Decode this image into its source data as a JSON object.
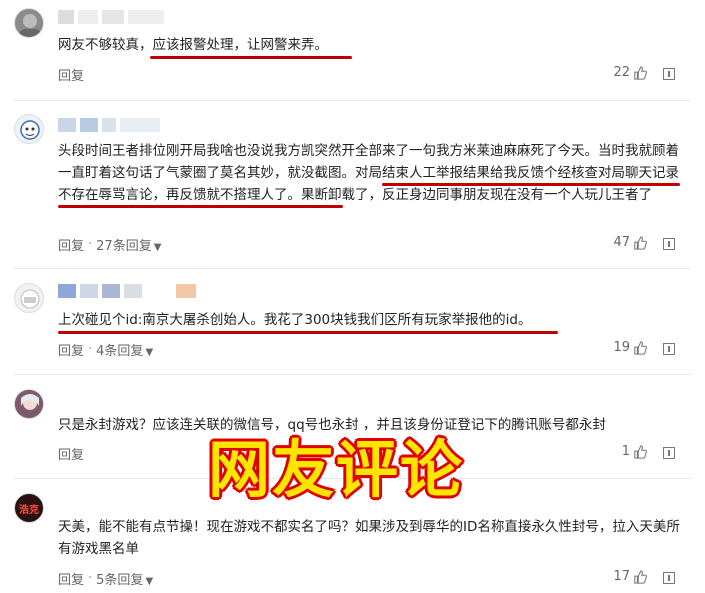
{
  "comments": [
    {
      "text": "网友不够较真，应该报警处理，让网警来弄。",
      "reply_label": "回复",
      "replies_label": "",
      "likes": "22"
    },
    {
      "text": "头段时间王者排位刚开局我啥也没说我方凯突然开全部来了一句我方米莱迪麻麻死了今天。当时我就顾着一直盯着这句话了气蒙圈了莫名其妙，就没截图。对局结束人工举报结果给我反馈个经核查对局聊天记录不存在辱骂言论，再反馈就不搭理人了。果断卸载了，反正身边同事朋友现在没有一个人玩儿王者了",
      "reply_label": "回复",
      "replies_label": "27条回复",
      "likes": "47"
    },
    {
      "text": "上次碰见个id:南京大屠杀创始人。我花了300块钱我们区所有玩家举报他的id。",
      "reply_label": "回复",
      "replies_label": "4条回复",
      "likes": "19"
    },
    {
      "text": "只是永封游戏？应该连关联的微信号，qq号也永封 ，并且该身份证登记下的腾讯账号都永封",
      "reply_label": "回复",
      "replies_label": "",
      "likes": "1"
    },
    {
      "text": "天美，能不能有点节操！现在游戏不都实名了吗？如果涉及到辱华的ID名称直接永久性封号，拉入天美所有游戏黑名单",
      "reply_label": "回复",
      "replies_label": "5条回复",
      "likes": "17"
    }
  ],
  "overlay_title": "网友评论",
  "avatar5_text": "浩克",
  "colors": {
    "highlight": "#c00000",
    "overlay_fill": "#ffe600",
    "overlay_stroke": "#e00000"
  },
  "icons": {
    "like": "thumbs-up-icon",
    "report": "report-icon"
  }
}
